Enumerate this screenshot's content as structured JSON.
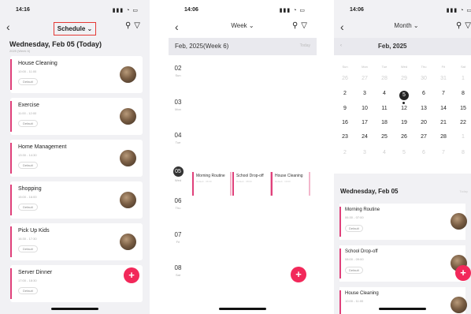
{
  "screen1": {
    "status_time": "14:16",
    "status_icons": "▮▮▮ ◔ ▭",
    "nav_title": "Schedule ⌄",
    "day_title": "Wednesday, Feb 05 (Today)",
    "day_sub": "2025 (Week 6)",
    "cards": [
      {
        "title": "House Cleaning",
        "meta": "10:00 - 11:00",
        "tag": "Default"
      },
      {
        "title": "Exercise",
        "meta": "11:00 - 12:00",
        "tag": "Default"
      },
      {
        "title": "Home Management",
        "meta": "13:30 - 14:30",
        "tag": "Default"
      },
      {
        "title": "Shopping",
        "meta": "15:00 - 16:00",
        "tag": "Default"
      },
      {
        "title": "Pick Up Kids",
        "meta": "16:30 - 17:30",
        "tag": "Default"
      },
      {
        "title": "Server Dinner",
        "meta": "17:00 - 18:30",
        "tag": "Default"
      }
    ],
    "fab": "+"
  },
  "screen2": {
    "status_time": "14:06",
    "status_icons": "▮▮▮ ◔ ▭",
    "nav_title": "Week ⌄",
    "header_title": "Feb, 2025(Week 6)",
    "header_right": "Today",
    "days": [
      {
        "num": "02",
        "wd": "Sun"
      },
      {
        "num": "03",
        "wd": "Mon"
      },
      {
        "num": "04",
        "wd": "Tue"
      },
      {
        "num": "05",
        "wd": "Wed"
      },
      {
        "num": "06",
        "wd": "Thu"
      },
      {
        "num": "07",
        "wd": "Fri"
      },
      {
        "num": "08",
        "wd": "Sat"
      }
    ],
    "events": [
      {
        "title": "Morning Routine",
        "detail": "Default · 06:30"
      },
      {
        "title": "School Drop-off",
        "detail": "Default · 08:00"
      },
      {
        "title": "House Cleaning",
        "detail": "Default · 10:00"
      }
    ],
    "fab": "+"
  },
  "screen3": {
    "status_time": "14:06",
    "status_icons": "▮▮▮ ◔ ▭",
    "nav_title": "Month ⌄",
    "month_title": "Feb, 2025",
    "prev_arrow": "‹",
    "weekday_heads": [
      "Sun",
      "Mon",
      "Tue",
      "Wed",
      "Thu",
      "Fri",
      "Sat"
    ],
    "weeks": [
      [
        "26",
        "27",
        "28",
        "29",
        "30",
        "31",
        "1"
      ],
      [
        "2",
        "3",
        "4",
        "5",
        "6",
        "7",
        "8"
      ],
      [
        "9",
        "10",
        "11",
        "12",
        "13",
        "14",
        "15"
      ],
      [
        "16",
        "17",
        "18",
        "19",
        "20",
        "21",
        "22"
      ],
      [
        "23",
        "24",
        "25",
        "26",
        "27",
        "28",
        "1"
      ],
      [
        "2",
        "3",
        "4",
        "5",
        "6",
        "7",
        "8"
      ]
    ],
    "day_title": "Wednesday, Feb 05",
    "day_right": "Today",
    "cards": [
      {
        "title": "Morning Routine",
        "meta": "06:30 - 07:00",
        "tag": "Default"
      },
      {
        "title": "School Drop-off",
        "meta": "08:00 - 09:00",
        "tag": "Default"
      },
      {
        "title": "House Cleaning",
        "meta": "10:00 - 11:00",
        "tag": "Default"
      }
    ],
    "fab": "+"
  },
  "icons": {
    "back": "back-chevron-icon",
    "search": "search-icon",
    "filter": "filter-icon",
    "add": "plus-icon",
    "avatar": "avatar-photo"
  },
  "colors": {
    "accent": "#f2285a",
    "event_bar": "#e0407a",
    "highlight_box": "#e53935"
  }
}
